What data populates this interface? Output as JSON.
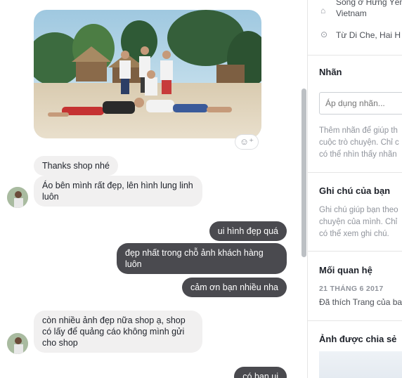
{
  "chat": {
    "messages": [
      {
        "dir": "in",
        "text": "Thanks shop nhé"
      },
      {
        "dir": "in",
        "text": "Áo bên mình rất đẹp, lên hình lung linh luôn"
      },
      {
        "dir": "out",
        "text": "ui hình đẹp quá"
      },
      {
        "dir": "out",
        "text": "đẹp nhất trong chỗ ảnh khách hàng luôn"
      },
      {
        "dir": "out",
        "text": "cảm ơn bạn nhiều nha"
      },
      {
        "dir": "in",
        "text": "còn nhiều ảnh đẹp nữa shop ạ, shop có lấy để quảng cáo không mình gửi cho shop"
      },
      {
        "dir": "out",
        "text": "có bạn ui"
      }
    ],
    "react_icon": "smiley-plus-icon"
  },
  "info": {
    "lives_in_line1": "Sống ở Hưng Yên,",
    "lives_in_line2": "Vietnam",
    "from": "Từ Di Che, Hai H",
    "labels_title": "Nhãn",
    "labels_placeholder": "Áp dụng nhãn...",
    "labels_help_1": "Thêm nhãn để giúp th",
    "labels_help_2": "cuộc trò chuyện. Chỉ c",
    "labels_help_3": "có thể nhìn thấy nhãn",
    "notes_title": "Ghi chú của bạn",
    "notes_help_1": "Ghi chú giúp bạn theo",
    "notes_help_2": "chuyện của mình. Chỉ",
    "notes_help_3": "có thể xem ghi chú.",
    "relationship_title": "Mối quan hệ",
    "relationship_date": "21 THÁNG 6 2017",
    "relationship_text": "Đã thích Trang của ba",
    "shared_title": "Ảnh được chia sẻ"
  }
}
